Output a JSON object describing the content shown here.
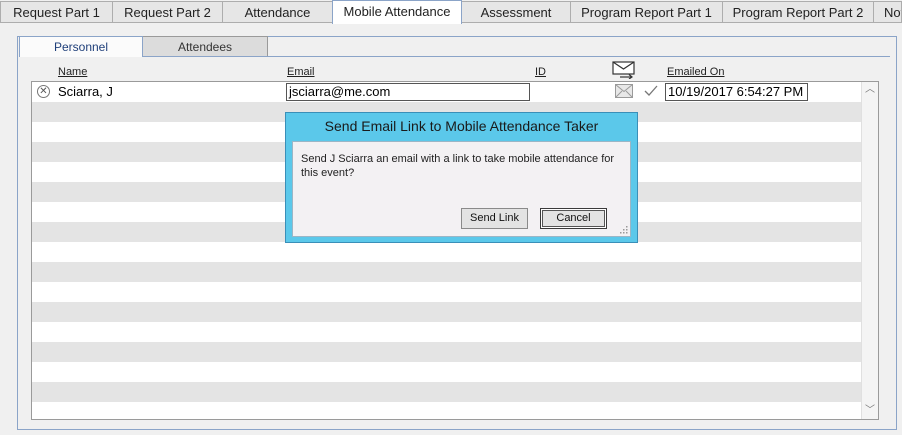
{
  "tabs": [
    {
      "label": "Request Part 1"
    },
    {
      "label": "Request Part 2"
    },
    {
      "label": "Attendance"
    },
    {
      "label": "Mobile Attendance",
      "active": true
    },
    {
      "label": "Assessment"
    },
    {
      "label": "Program Report Part 1"
    },
    {
      "label": "Program Report Part 2"
    },
    {
      "label": "Not"
    }
  ],
  "subtabs": [
    {
      "label": "Personnel",
      "active": true
    },
    {
      "label": "Attendees"
    }
  ],
  "columns": {
    "name": "Name",
    "email": "Email",
    "id": "ID",
    "emailed_on": "Emailed On"
  },
  "rows": [
    {
      "name": "Sciarra, J",
      "email": "jsciarra@me.com",
      "id": "",
      "emailed_on": "10/19/2017 6:54:27 PM",
      "sent": true
    }
  ],
  "dialog": {
    "title": "Send Email Link to Mobile Attendance Taker",
    "message": "Send J Sciarra an email with a link to take mobile attendance for this event?",
    "send_label": "Send Link",
    "cancel_label": "Cancel"
  },
  "icons": {
    "remove": "remove-circle-icon",
    "email_header": "envelope-send-icon",
    "email_row": "envelope-icon",
    "sent": "checkmark-icon"
  },
  "colors": {
    "dialog_title_bg": "#5bc8ea",
    "stripe": "#e4e4e4",
    "active_tab_text": "#1f3f7a"
  }
}
